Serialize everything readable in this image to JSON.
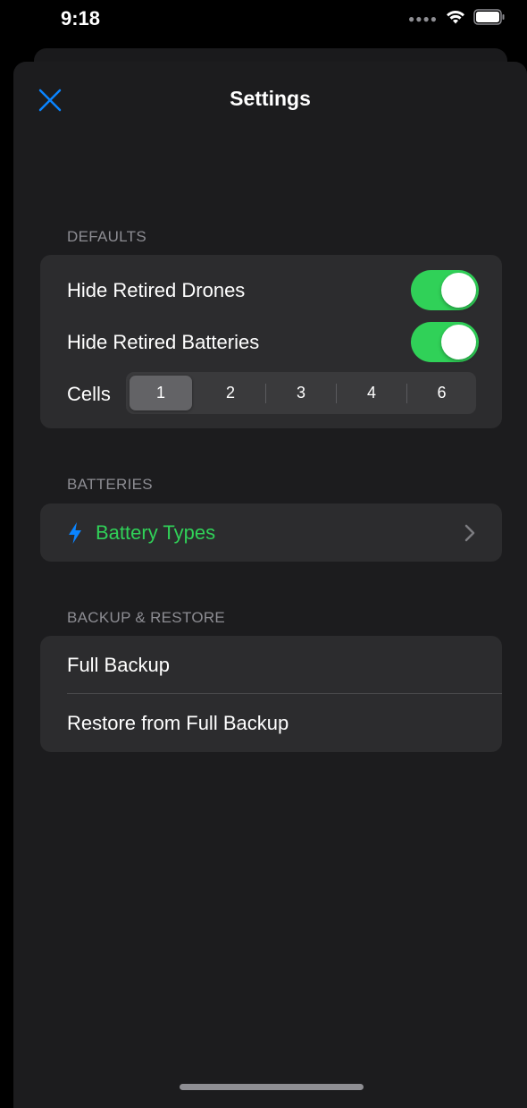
{
  "status_bar": {
    "time": "9:18",
    "signal_icon": "signal-dots-icon",
    "wifi_icon": "wifi-icon",
    "battery_icon": "battery-icon"
  },
  "nav": {
    "title": "Settings",
    "close_icon": "close-icon",
    "accent_color": "#0a84ff"
  },
  "sections": {
    "defaults": {
      "header": "DEFAULTS",
      "hide_retired_drones": {
        "label": "Hide Retired Drones",
        "on": true
      },
      "hide_retired_batteries": {
        "label": "Hide Retired Batteries",
        "on": true
      },
      "cells": {
        "label": "Cells",
        "options": [
          "1",
          "2",
          "3",
          "4",
          "6"
        ],
        "selected": "1"
      }
    },
    "batteries": {
      "header": "BATTERIES",
      "battery_types": {
        "label": "Battery Types",
        "icon": "lightning-bolt-icon",
        "color": "#30d158"
      }
    },
    "backup_restore": {
      "header": "BACKUP & RESTORE",
      "full_backup": "Full Backup",
      "restore": "Restore from Full Backup"
    }
  },
  "colors": {
    "toggle_on": "#30d158",
    "sheet_background": "#1c1c1e",
    "group_background": "#2c2c2e"
  }
}
